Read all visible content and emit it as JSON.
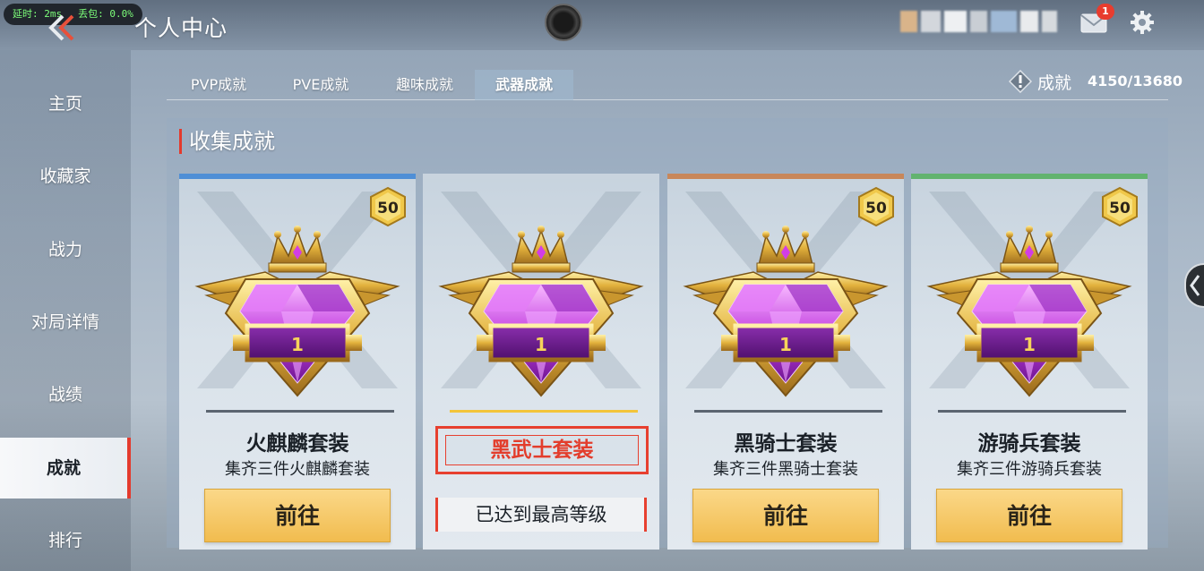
{
  "net_stats": {
    "latency": "延时: 2ms",
    "loss": "丢包: 0.0%"
  },
  "header": {
    "title": "个人中心",
    "mail_count": "1"
  },
  "sidebar": {
    "items": [
      {
        "label": "主页"
      },
      {
        "label": "收藏家"
      },
      {
        "label": "战力"
      },
      {
        "label": "对局详情"
      },
      {
        "label": "战绩"
      },
      {
        "label": "成就",
        "active": true
      },
      {
        "label": "排行"
      }
    ]
  },
  "tabs": [
    {
      "label": "PVP成就"
    },
    {
      "label": "PVE成就"
    },
    {
      "label": "趣味成就"
    },
    {
      "label": "武器成就",
      "active": true
    }
  ],
  "achievement": {
    "label": "成就",
    "value": "4150/13680"
  },
  "section": {
    "title": "收集成就"
  },
  "cards": [
    {
      "level_badge": "50",
      "emblem_number": "1",
      "name": "火麒麟套装",
      "desc": "集齐三件火麒麟套装",
      "button": "前往",
      "accent": "#4f8fd6"
    },
    {
      "emblem_number": "1",
      "name": "黑武士套装",
      "status": "已达到最高等级",
      "accent": "#c9d4de",
      "selected": true
    },
    {
      "level_badge": "50",
      "emblem_number": "1",
      "name": "黑骑士套装",
      "desc": "集齐三件黑骑士套装",
      "button": "前往",
      "accent": "#c8875a"
    },
    {
      "level_badge": "50",
      "emblem_number": "1",
      "name": "游骑兵套装",
      "desc": "集齐三件游骑兵套装",
      "button": "前往",
      "accent": "#62b36f"
    }
  ],
  "colors": {
    "active_red": "#e43a2d",
    "gold_button": "#f1bc4f",
    "gem_purple": "#b23fd6"
  }
}
